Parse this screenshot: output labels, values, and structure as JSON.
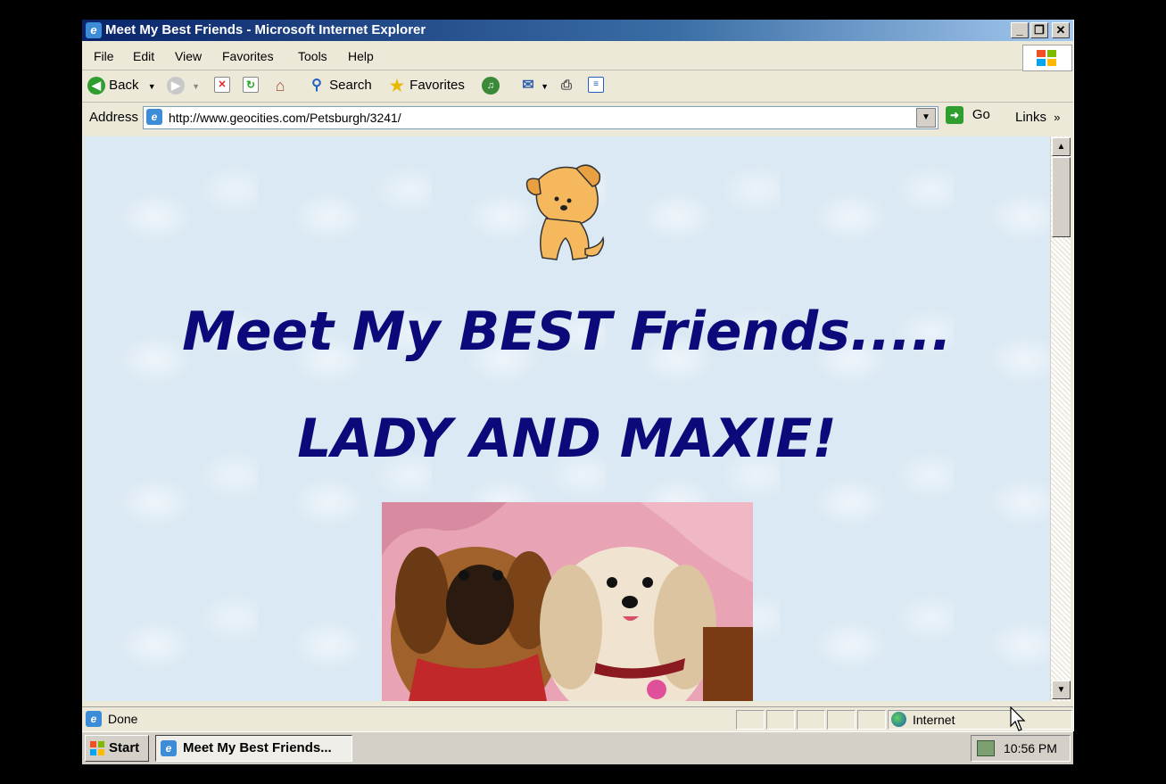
{
  "window": {
    "title": "Meet My Best Friends - Microsoft Internet Explorer"
  },
  "menu": [
    "File",
    "Edit",
    "View",
    "Favorites",
    "Tools",
    "Help"
  ],
  "toolbar": {
    "back": "Back",
    "search": "Search",
    "favorites": "Favorites"
  },
  "address": {
    "label": "Address",
    "url": "http://www.geocities.com/Petsburgh/3241/",
    "go": "Go",
    "links": "Links"
  },
  "page": {
    "heading1": "Meet My BEST Friends.....",
    "heading2": "LADY AND MAXIE!"
  },
  "status": {
    "text": "Done",
    "zone": "Internet"
  },
  "taskbar": {
    "start": "Start",
    "task": "Meet My Best Friends...",
    "clock": "10:56 PM"
  }
}
